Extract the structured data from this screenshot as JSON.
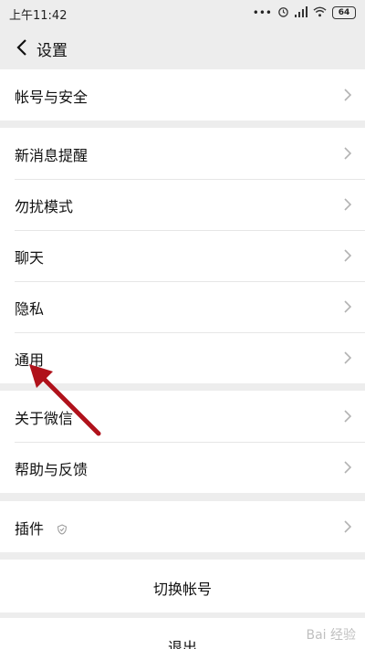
{
  "status_bar": {
    "time": "上午11:42",
    "dots": "•••",
    "battery": "64"
  },
  "nav": {
    "title": "设置"
  },
  "sections": {
    "account": "帐号与安全",
    "notifications": "新消息提醒",
    "dnd": "勿扰模式",
    "chat": "聊天",
    "privacy": "隐私",
    "general": "通用",
    "about": "关于微信",
    "help": "帮助与反馈",
    "plugins": "插件"
  },
  "actions": {
    "switch_account": "切换帐号",
    "logout": "退出"
  },
  "watermark": "Bai 经验",
  "colors": {
    "background": "#ededed",
    "arrow": "#b0121b"
  }
}
